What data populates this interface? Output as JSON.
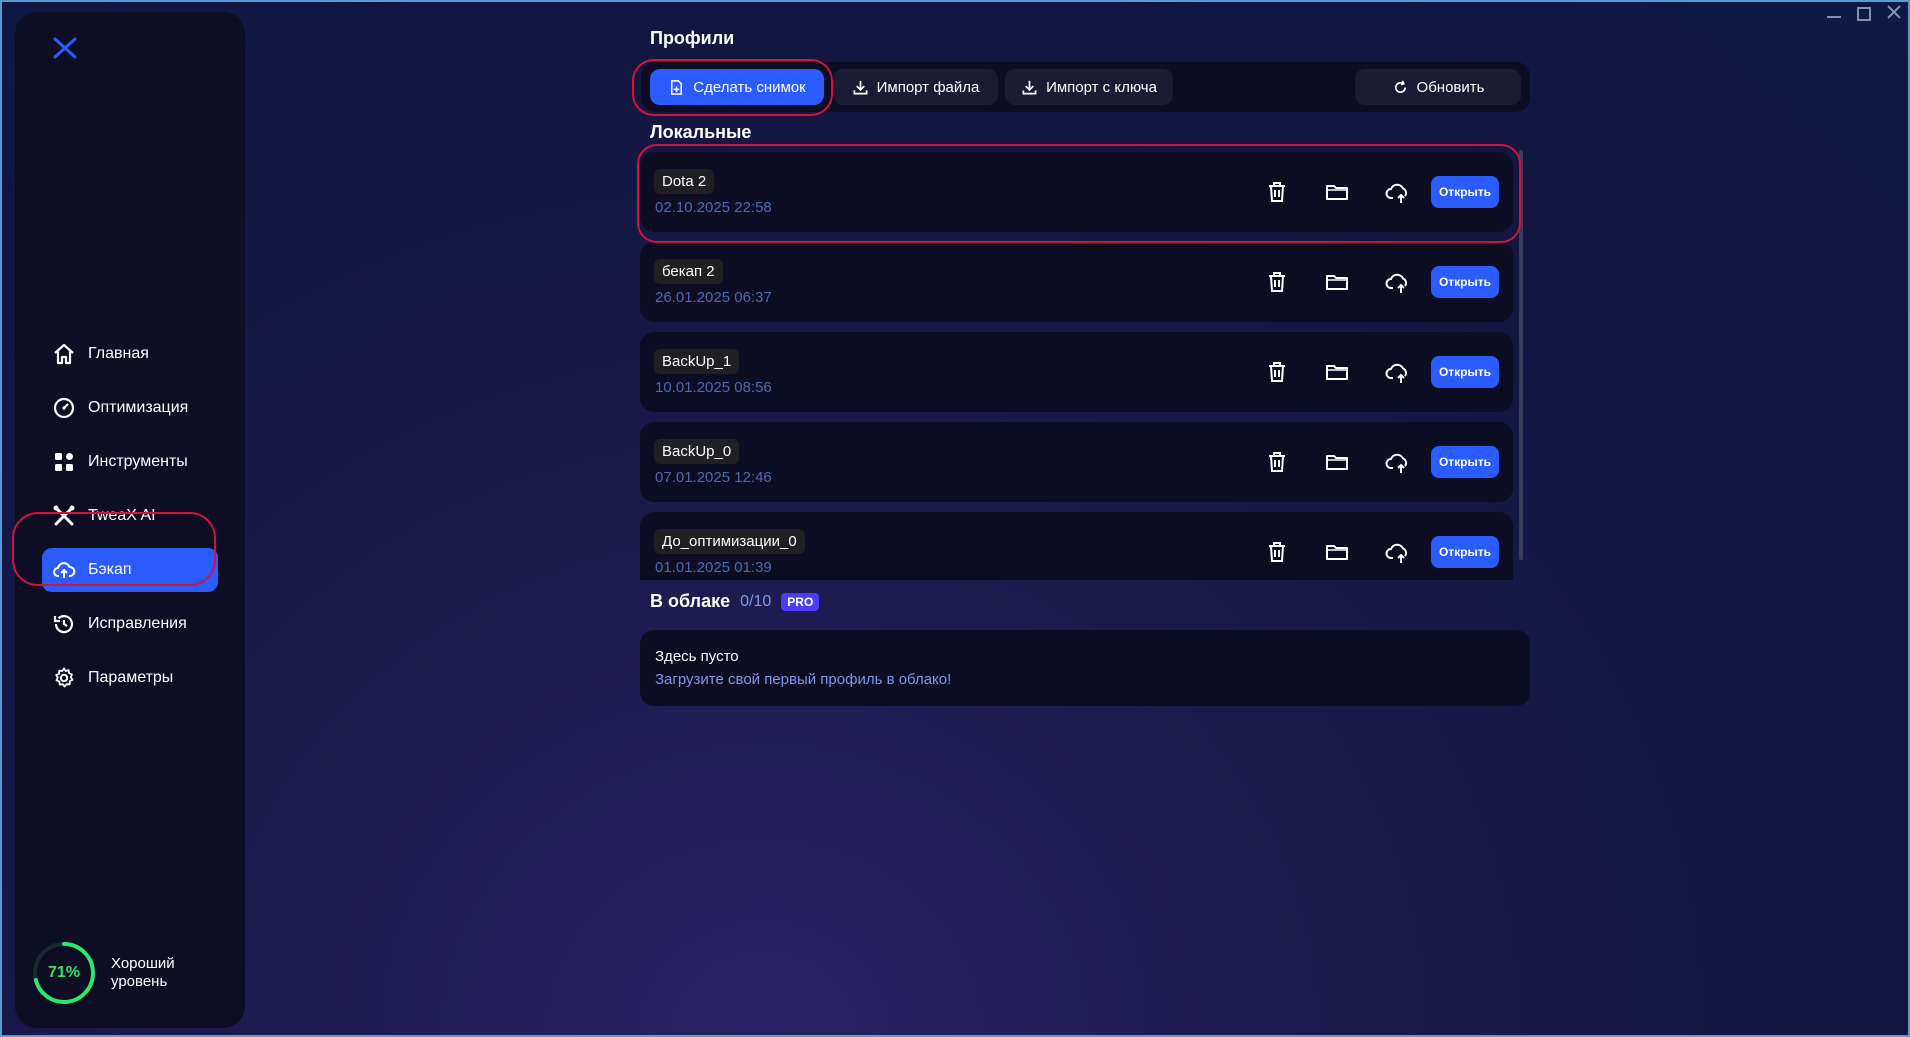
{
  "sidebar": {
    "items": [
      {
        "label": "Главная",
        "icon": "home-icon"
      },
      {
        "label": "Оптимизация",
        "icon": "gauge-icon"
      },
      {
        "label": "Инструменты",
        "icon": "grid-icon"
      },
      {
        "label": "TweaX AI",
        "icon": "tweax-ai-icon"
      },
      {
        "label": "Бэкап",
        "icon": "cloud-upload-icon",
        "active": true
      },
      {
        "label": "Исправления",
        "icon": "history-icon"
      },
      {
        "label": "Параметры",
        "icon": "gear-icon"
      }
    ],
    "level": {
      "percent_label": "71%",
      "value": 0.71,
      "text": "Хороший уровень"
    }
  },
  "profiles": {
    "title": "Профили",
    "toolbar": {
      "snapshot_label": "Сделать снимок",
      "import_file_label": "Импорт файла",
      "import_key_label": "Импорт с ключа",
      "refresh_label": "Обновить"
    },
    "local_title": "Локальные",
    "open_label": "Открыть",
    "local": [
      {
        "name": "Dota 2",
        "date": "02.10.2025 22:58"
      },
      {
        "name": "бекап 2",
        "date": "26.01.2025 06:37"
      },
      {
        "name": "BackUp_1",
        "date": "10.01.2025 08:56"
      },
      {
        "name": "BackUp_0",
        "date": "07.01.2025 12:46"
      },
      {
        "name": "До_оптимизации_0",
        "date": "01.01.2025 01:39"
      }
    ],
    "cloud": {
      "title": "В облаке",
      "count": "0/10",
      "badge": "PRO",
      "empty_title": "Здесь пусто",
      "empty_hint": "Загрузите свой первый профиль в облако!"
    }
  },
  "colors": {
    "accent": "#2a5cff",
    "highlight": "#d0143c",
    "level": "#2ee66a"
  }
}
